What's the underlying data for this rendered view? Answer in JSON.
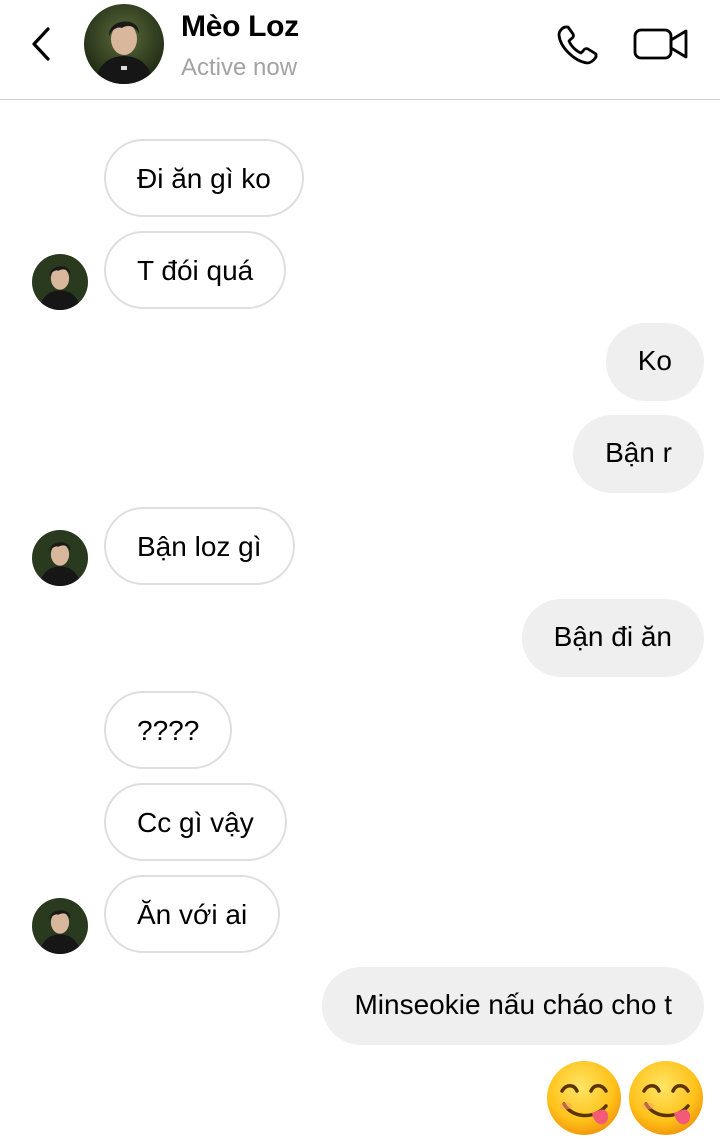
{
  "header": {
    "contact_name": "Mèo Loz",
    "status": "Active now",
    "back_icon": "chevron-left-icon",
    "call_icon": "phone-icon",
    "video_icon": "video-camera-icon"
  },
  "messages": [
    {
      "sender": "contact",
      "text": "Đi ăn gì ko"
    },
    {
      "sender": "contact",
      "text": "T đói quá"
    },
    {
      "sender": "me",
      "text": "Ko"
    },
    {
      "sender": "me",
      "text": "Bận r"
    },
    {
      "sender": "contact",
      "text": "Bận loz gì"
    },
    {
      "sender": "me",
      "text": "Bận đi ăn"
    },
    {
      "sender": "contact",
      "text": "????"
    },
    {
      "sender": "contact",
      "text": "Cc gì vậy"
    },
    {
      "sender": "contact",
      "text": "Ăn với ai"
    },
    {
      "sender": "me",
      "text": "Minseokie nấu cháo cho t"
    }
  ],
  "emoji_message": {
    "sender": "me",
    "emojis": [
      "face-savoring-food-emoji",
      "face-savoring-food-emoji"
    ]
  },
  "colors": {
    "incoming_border": "#dedede",
    "outgoing_bg": "#efefef",
    "status_text": "#a3a3a3",
    "divider": "#cfcfcf"
  }
}
